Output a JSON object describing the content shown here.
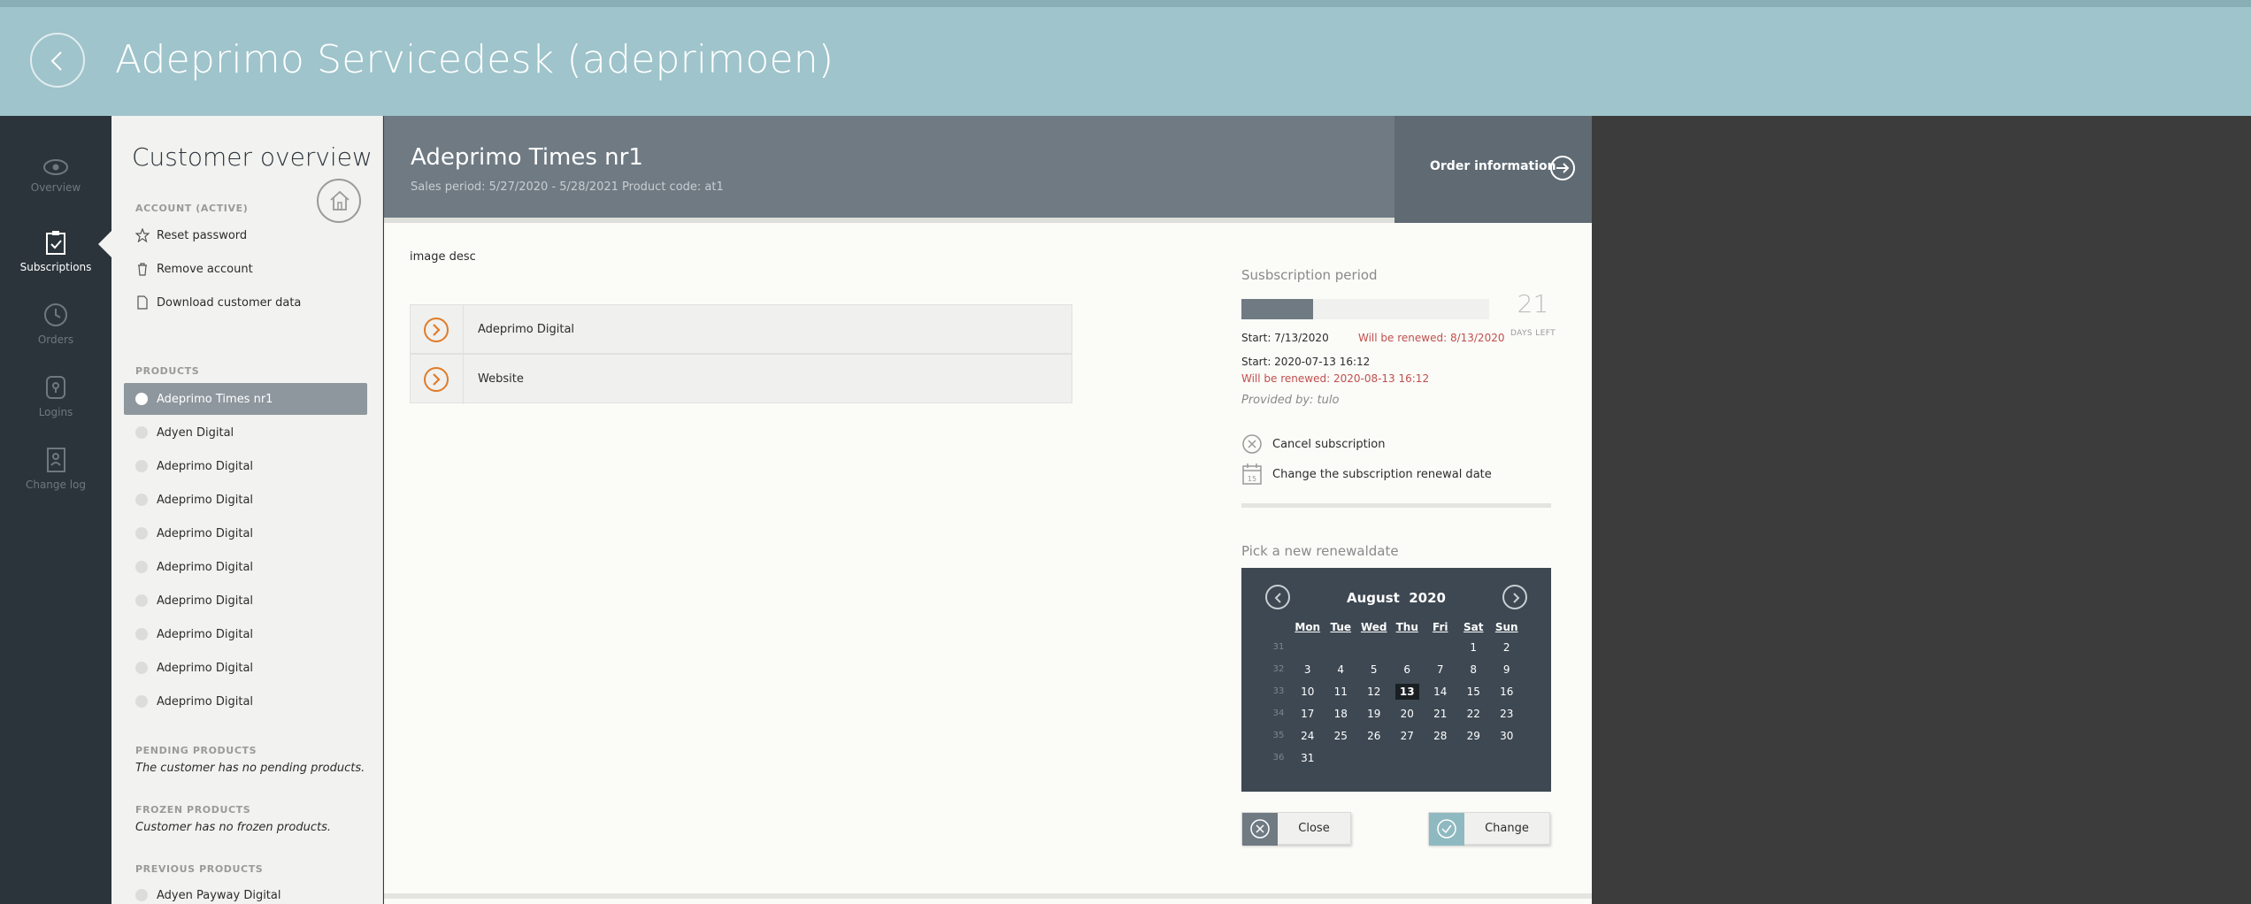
{
  "app": {
    "title": "Adeprimo Servicedesk (adeprimoen)"
  },
  "nav": {
    "items": [
      {
        "label": "Overview",
        "icon": "eye-icon"
      },
      {
        "label": "Subscriptions",
        "icon": "clipboard-check-icon",
        "active": true
      },
      {
        "label": "Orders",
        "icon": "history-clock-icon"
      },
      {
        "label": "Logins",
        "icon": "lock-icon"
      },
      {
        "label": "Change log",
        "icon": "contact-book-icon"
      }
    ]
  },
  "customer": {
    "title": "Customer overview",
    "account_heading": "ACCOUNT (ACTIVE)",
    "actions": [
      "Reset password",
      "Remove account",
      "Download customer data"
    ],
    "products_heading": "PRODUCTS",
    "products": [
      "Adeprimo Times nr1",
      "Adyen Digital",
      "Adeprimo Digital",
      "Adeprimo Digital",
      "Adeprimo Digital",
      "Adeprimo Digital",
      "Adeprimo Digital",
      "Adeprimo Digital",
      "Adeprimo Digital",
      "Adeprimo Digital"
    ],
    "pending_heading": "PENDING PRODUCTS",
    "pending_note": "The customer has no pending products.",
    "frozen_heading": "FROZEN PRODUCTS",
    "frozen_note": "Customer has no frozen products.",
    "previous_heading": "PREVIOUS PRODUCTS",
    "previous_products": [
      "Adyen Payway Digital"
    ]
  },
  "product": {
    "title": "Adeprimo Times nr1",
    "subtitle": "Sales period: 5/27/2020 - 5/28/2021 Product code: at1",
    "order_info_label": "Order information",
    "image_desc": "image desc",
    "links": [
      "Adeprimo Digital",
      "Website"
    ]
  },
  "subscription": {
    "heading": "Susbscription period",
    "progress_fraction": 0.29,
    "days_left": "21",
    "days_left_label": "DAYS LEFT",
    "start_short": "Start: 7/13/2020",
    "renew_short": "Will be renewed: 8/13/2020",
    "start_full": "Start: 2020-07-13 16:12",
    "renew_full": "Will be renewed: 2020-08-13 16:12",
    "provided_by": "Provided by: tulo",
    "cancel_label": "Cancel subscription",
    "change_date_label": "Change the subscription renewal date",
    "pick_heading": "Pick a new renewaldate"
  },
  "calendar": {
    "month": "August",
    "year": "2020",
    "weekdays": [
      "Mon",
      "Tue",
      "Wed",
      "Thu",
      "Fri",
      "Sat",
      "Sun"
    ],
    "weeks": [
      {
        "wk": "31",
        "days": [
          "",
          "",
          "",
          "",
          "",
          "1",
          "2"
        ]
      },
      {
        "wk": "32",
        "days": [
          "3",
          "4",
          "5",
          "6",
          "7",
          "8",
          "9"
        ]
      },
      {
        "wk": "33",
        "days": [
          "10",
          "11",
          "12",
          "13",
          "14",
          "15",
          "16"
        ]
      },
      {
        "wk": "34",
        "days": [
          "17",
          "18",
          "19",
          "20",
          "21",
          "22",
          "23"
        ]
      },
      {
        "wk": "35",
        "days": [
          "24",
          "25",
          "26",
          "27",
          "28",
          "29",
          "30"
        ]
      },
      {
        "wk": "36",
        "days": [
          "31",
          "",
          "",
          "",
          "",
          "",
          ""
        ]
      }
    ],
    "highlighted_day": "13"
  },
  "buttons": {
    "close": "Close",
    "change": "Change"
  },
  "colors": {
    "header_bg": "#9fc4cb",
    "nav_bg": "#2b343b",
    "product_header_bg": "#6f7a83",
    "accent_orange": "#e07b28",
    "renew_red": "#c0504d",
    "calendar_bg": "#3d4852"
  }
}
